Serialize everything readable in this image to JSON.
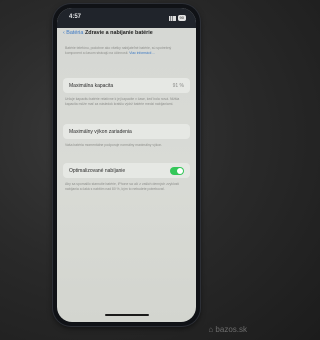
{
  "status": {
    "time": "4:57",
    "battery": "90"
  },
  "nav": {
    "back_label": "Batéria",
    "title": "Zdravie a nabíjanie batérie"
  },
  "intro": {
    "text": "Batérie telefónu, podobne ako všetky nabíjateľné batérie, sú spotrebný komponent a časom strácajú na účinnosti.",
    "link": "Viac informácií…"
  },
  "capacity": {
    "label": "Maximálna kapacita",
    "value": "91 %",
    "note": "Určuje kapacitu batérie relatívne k jej kapacite v čase, keď bola nová. Nižšia kapacita môže mať za následok kratšiu výdrž batérie medzi nabíjaniami."
  },
  "performance": {
    "label": "Maximálny výkon zariadenia",
    "note": "Vaša batéria momentálne podporuje normálny maximálny výkon."
  },
  "optimized": {
    "label": "Optimalizované nabíjanie",
    "on": true,
    "note": "Aby sa spomalilo starnutie batérie, iPhone sa učí z vašich denných zvyklostí nabíjania a čaká s nabitím nad 80 %, kým to nebudete potrebovať."
  },
  "watermark": "bazos.sk"
}
